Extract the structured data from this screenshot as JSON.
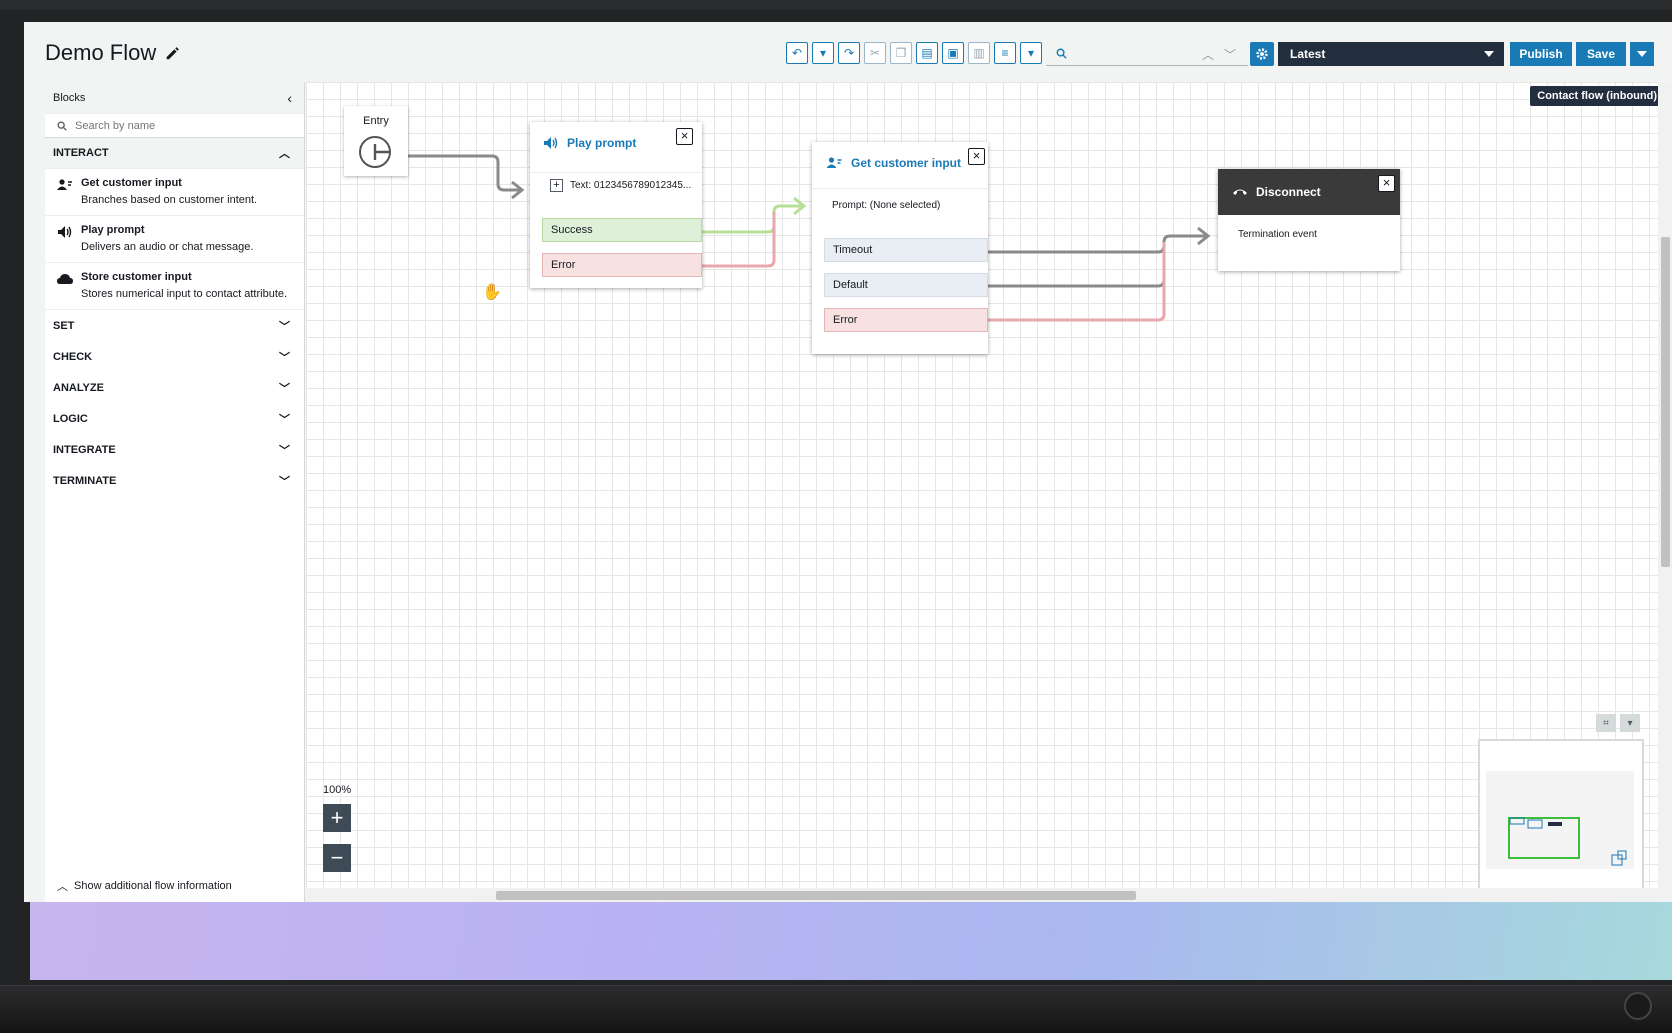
{
  "flow": {
    "title": "Demo Flow",
    "type_label": "Contact flow (inbound)"
  },
  "toolbar": {
    "version_label": "Latest",
    "publish_label": "Publish",
    "save_label": "Save",
    "search_placeholder": ""
  },
  "sidebar": {
    "title": "Blocks",
    "search_placeholder": "Search by name",
    "categories": [
      {
        "label": "INTERACT",
        "expanded": true
      },
      {
        "label": "SET"
      },
      {
        "label": "CHECK"
      },
      {
        "label": "ANALYZE"
      },
      {
        "label": "LOGIC"
      },
      {
        "label": "INTEGRATE"
      },
      {
        "label": "TERMINATE"
      }
    ],
    "blocks": [
      {
        "title": "Get customer input",
        "desc": "Branches based on customer intent.",
        "icon": "customer-input-icon"
      },
      {
        "title": "Play prompt",
        "desc": "Delivers an audio or chat message.",
        "icon": "speaker-icon"
      },
      {
        "title": "Store customer input",
        "desc": "Stores numerical input to contact attribute.",
        "icon": "cloud-icon"
      }
    ],
    "footer_label": "Show additional flow information"
  },
  "canvas": {
    "entry_label": "Entry",
    "zoom_label": "100%",
    "nodes": {
      "play_prompt": {
        "title": "Play prompt",
        "text": "Text: 0123456789012345...",
        "branches": [
          "Success",
          "Error"
        ]
      },
      "get_input": {
        "title": "Get customer input",
        "prompt": "Prompt: (None selected)",
        "branches": [
          "Timeout",
          "Default",
          "Error"
        ]
      },
      "disconnect": {
        "title": "Disconnect",
        "event": "Termination event"
      }
    }
  },
  "colors": {
    "accent": "#1a7ab5",
    "dark": "#232f3e",
    "success": "#dff0d8",
    "error": "#f8e1e1"
  }
}
